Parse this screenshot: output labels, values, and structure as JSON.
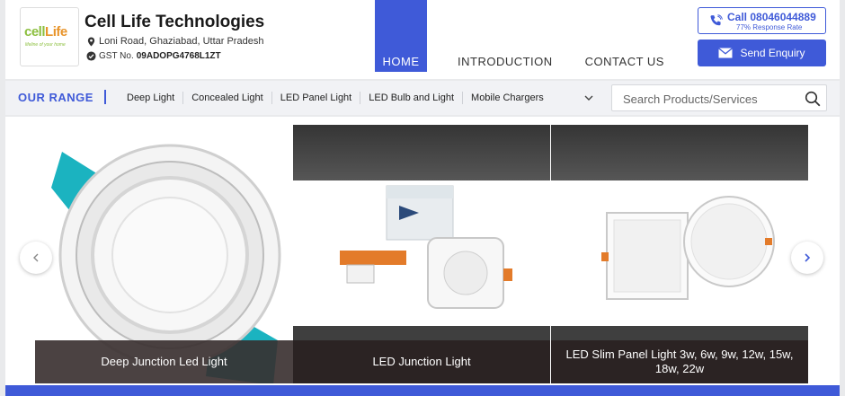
{
  "company": {
    "logo_text_a": "cell",
    "logo_text_b": "Life",
    "logo_tagline": "lifeline of your home",
    "name": "Cell Life Technologies",
    "address": "Loni Road, Ghaziabad, Uttar Pradesh",
    "gst_label": "GST No.",
    "gst_number": "09ADOPG4768L1ZT"
  },
  "nav": {
    "items": [
      {
        "label": "HOME",
        "active": true
      },
      {
        "label": "INTRODUCTION",
        "active": false
      },
      {
        "label": "CONTACT US",
        "active": false
      }
    ]
  },
  "contact": {
    "call_label": "Call 08046044889",
    "response_rate": "77% Response Rate",
    "enquiry_label": "Send Enquiry",
    "icons": [
      "phone-icon",
      "envelope-icon"
    ]
  },
  "range": {
    "title": "OUR RANGE",
    "items": [
      "Deep Light",
      "Concealed Light",
      "LED Panel Light",
      "LED Bulb and Light",
      "Mobile Chargers"
    ],
    "more_icon": "chevron-down-icon"
  },
  "search": {
    "placeholder": "Search Products/Services",
    "icon": "search-icon"
  },
  "carousel": {
    "slides": [
      {
        "caption": "Deep Junction Led Light"
      },
      {
        "caption": "LED Junction Light"
      },
      {
        "caption": "LED Slim Panel Light 3w, 6w, 9w, 12w, 15w, 18w, 22w"
      }
    ],
    "prev_icon": "chevron-left-icon",
    "next_icon": "chevron-right-icon"
  },
  "colors": {
    "brand_blue": "#3f5ad8",
    "logo_green": "#8cbf3f",
    "logo_orange": "#e8942a"
  }
}
